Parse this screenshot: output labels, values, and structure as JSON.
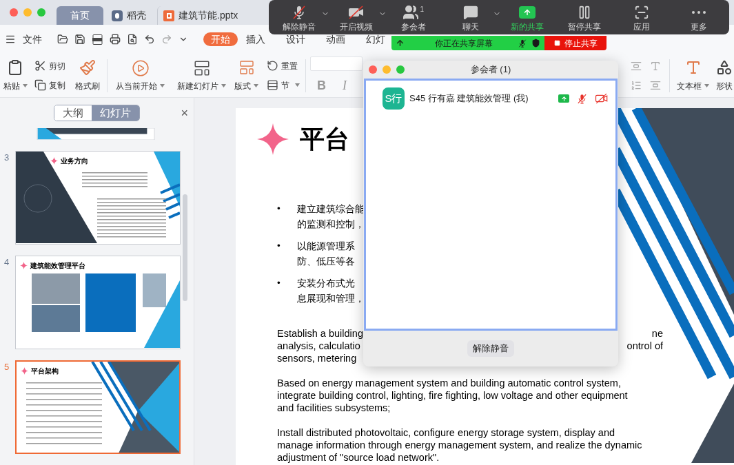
{
  "window": {
    "tabs": [
      {
        "label": "首页",
        "kind": "home",
        "selected": true
      },
      {
        "label": "稻壳",
        "kind": "docer",
        "selected": false
      },
      {
        "label": "建筑节能.pptx",
        "kind": "file",
        "selected": false
      }
    ]
  },
  "menu": {
    "file": "文件",
    "tabs": [
      {
        "label": "开始",
        "selected": true
      },
      {
        "label": "插入",
        "selected": false
      },
      {
        "label": "设计",
        "selected": false
      },
      {
        "label": "动画",
        "selected": false
      },
      {
        "label": "幻灯",
        "selected": false
      }
    ]
  },
  "ribbon": {
    "paste": "粘贴",
    "cut": "剪切",
    "copy": "复制",
    "format_painter": "格式刷",
    "play": "从当前开始",
    "new_slide": "新建幻灯片",
    "layout": "版式",
    "reset": "重置",
    "section": "节",
    "bold": "B",
    "italic": "I",
    "text_box": "文本框",
    "shape": "形状"
  },
  "sidebar": {
    "tabs": [
      {
        "label": "大纲",
        "selected": false
      },
      {
        "label": "幻灯片",
        "selected": true
      }
    ],
    "close": "×",
    "slides": [
      {
        "number": "3",
        "title": "业务方向",
        "kind": "dark",
        "selected": false
      },
      {
        "number": "4",
        "title": "建筑能效管理平台",
        "kind": "photos",
        "selected": false
      },
      {
        "number": "5",
        "title": "平台架构",
        "kind": "stripes",
        "selected": true
      }
    ]
  },
  "slide": {
    "title": "平台",
    "bullets": [
      {
        "marker": "•",
        "lines": [
          "建立建筑综合能",
          "的监测和控制，"
        ]
      },
      {
        "marker": "•",
        "lines": [
          "以能源管理系",
          "防、低压等各"
        ]
      },
      {
        "marker": "•",
        "lines": [
          "安装分布式光",
          "息展现和管理，"
        ]
      }
    ],
    "paragraphs": [
      {
        "lines": [
          {
            "left": "Establish a building",
            "right": "ne"
          },
          {
            "left": "analysis, calculatio",
            "right": "ontrol of"
          },
          {
            "left": "sensors, metering"
          }
        ]
      },
      {
        "lines": [
          {
            "left": "Based on energy management system and building automatic control system,"
          },
          {
            "left": "integrate building control, lighting, fire fighting, low voltage and other equipment"
          },
          {
            "left": "and facilities subsystems;"
          }
        ]
      },
      {
        "lines": [
          {
            "left": "Install distributed photovoltaic, configure energy storage system, display and"
          },
          {
            "left": "manage information through energy management system, and realize the dynamic"
          },
          {
            "left": "adjustment of \"source load network\"."
          }
        ]
      }
    ]
  },
  "meeting": {
    "toolbar": [
      {
        "label": "解除静音",
        "kind": "mic",
        "muted": true,
        "menu": true,
        "active": false
      },
      {
        "label": "开启视频",
        "kind": "video",
        "muted": true,
        "menu": true,
        "active": false
      },
      {
        "label": "参会者",
        "kind": "participants",
        "count": "1",
        "menu": false,
        "active": false
      },
      {
        "label": "聊天",
        "kind": "chat",
        "menu": true,
        "active": false
      },
      {
        "label": "新的共享",
        "kind": "share",
        "menu": false,
        "active": true
      },
      {
        "label": "暂停共享",
        "kind": "pause",
        "menu": false,
        "active": false
      },
      {
        "label": "应用",
        "kind": "apps",
        "menu": false,
        "active": false
      },
      {
        "label": "更多",
        "kind": "more",
        "menu": false,
        "active": false
      }
    ],
    "banner": {
      "text": "你正在共享屏幕",
      "stop": "停止共享"
    },
    "participants_window": {
      "title": "参会者 (1)",
      "participants": [
        {
          "avatar": "S行",
          "name": "S45 行有嘉 建筑能效管理 (我)",
          "sharing": true,
          "muted": true,
          "video_off": true
        }
      ],
      "unmute": "解除静音"
    }
  }
}
